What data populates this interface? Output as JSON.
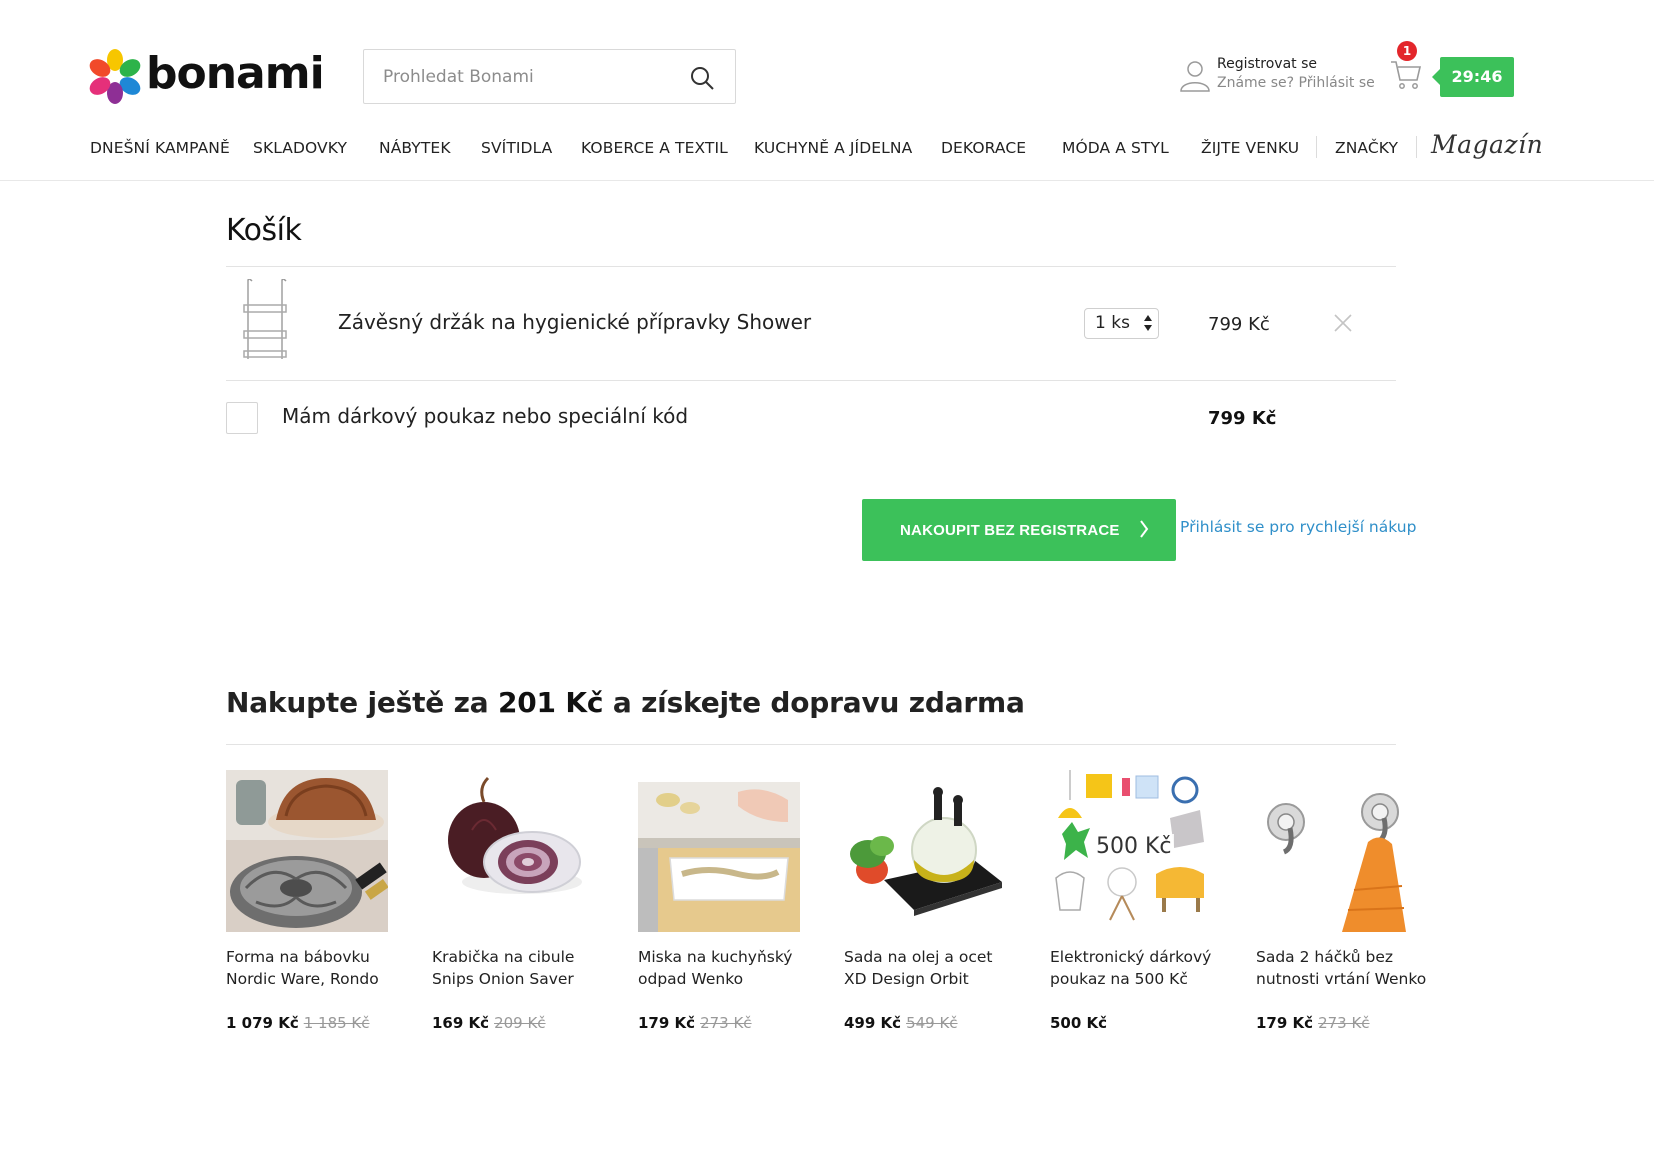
{
  "brand": {
    "name": "bonami",
    "accent": "#3cc15a",
    "link_color": "#2f8fc9"
  },
  "search": {
    "placeholder": "Prohledat Bonami"
  },
  "account": {
    "register": "Registrovat se",
    "known": "Známe se?",
    "login": "Přihlásit se"
  },
  "cart_badge": "1",
  "timer": "29:46",
  "nav": [
    "DNEŠNÍ KAMPANĚ",
    "SKLADOVKY",
    "NÁBYTEK",
    "SVÍTIDLA",
    "KOBERCE A TEXTIL",
    "KUCHYNĚ A JÍDELNA",
    "DEKORACE",
    "MÓDA A STYL",
    "ŽIJTE VENKU",
    "ZNAČKY"
  ],
  "magazin": "Magazín",
  "cart": {
    "title": "Košík",
    "item": {
      "name": "Závěsný držák na hygienické přípravky Shower",
      "qty": "1 ks",
      "price": "799 Kč"
    },
    "voucher_label": "Mám dárkový poukaz nebo speciální kód",
    "total": "799 Kč",
    "checkout_label": "NAKOUPIT BEZ REGISTRACE",
    "login_link": "Přihlásit se pro rychlejší nákup"
  },
  "free_shipping": {
    "prefix": "Nakupte ještě za",
    "amount": "201 Kč",
    "suffix": "a získejte dopravu zdarma"
  },
  "products": [
    {
      "name": "Forma na bábovku Nordic Ware, Rondo",
      "price": "1 079 Kč",
      "old_price": "1 185 Kč"
    },
    {
      "name": "Krabička na cibule Snips Onion Saver",
      "price": "169 Kč",
      "old_price": "209 Kč"
    },
    {
      "name": "Miska na kuchyňský odpad Wenko",
      "price": "179 Kč",
      "old_price": "273 Kč"
    },
    {
      "name": "Sada na olej a ocet XD Design Orbit",
      "price": "499 Kč",
      "old_price": "549 Kč"
    },
    {
      "name": "Elektronický dárkový poukaz na 500 Kč",
      "price": "500 Kč",
      "old_price": "",
      "image_text": "500 Kč"
    },
    {
      "name": "Sada 2 háčků bez nutnosti vrtání Wenko",
      "price": "179 Kč",
      "old_price": "273 Kč"
    }
  ]
}
